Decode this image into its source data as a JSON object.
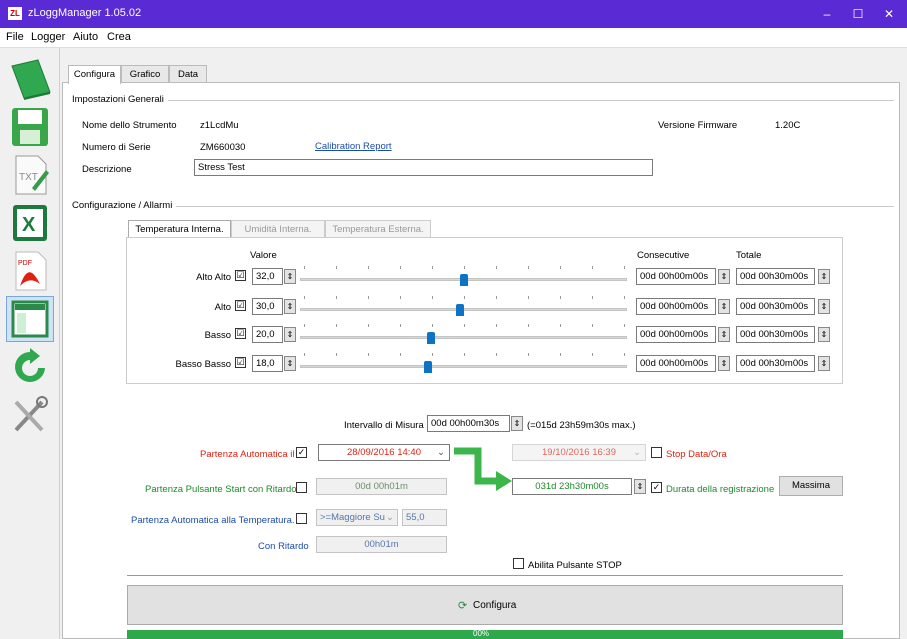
{
  "window": {
    "app_badge": "ZL",
    "title": "zLoggManager 1.05.02",
    "minimize": "–",
    "maximize": "☐",
    "close": "✕"
  },
  "menu": [
    "File",
    "Logger",
    "Aiuto",
    "Crea"
  ],
  "sidebar": [
    {
      "name": "book-icon"
    },
    {
      "name": "save-icon"
    },
    {
      "name": "txt-file-icon"
    },
    {
      "name": "excel-icon"
    },
    {
      "name": "pdf-icon"
    },
    {
      "name": "window-layout-icon"
    },
    {
      "name": "refresh-icon"
    },
    {
      "name": "tools-icon"
    }
  ],
  "tabs": [
    "Configura",
    "Grafico",
    "Data"
  ],
  "general": {
    "section_title": "Impostazioni Generali",
    "instrument_label": "Nome dello Strumento",
    "instrument_value": "z1LcdMu",
    "serial_label": "Numero di Serie",
    "serial_value": "ZM660030",
    "calibration_link": "Calibration Report",
    "description_label": "Descrizione",
    "description_value": "Stress Test",
    "firmware_label": "Versione Firmware",
    "firmware_value": "1.20C"
  },
  "config": {
    "section_title": "Configurazione / Allarmi",
    "subtabs": [
      "Temperatura Interna.",
      "Umidità Interna.",
      "Temperatura Esterna."
    ],
    "valore_header": "Valore",
    "consecutive_header": "Consecutive",
    "totale_header": "Totale",
    "alarms": [
      {
        "label": "Alto Alto",
        "checked": "☑",
        "value": "32,0",
        "level": 0.5,
        "consecutive": "00d 00h00m00s",
        "totale": "00d 00h30m00s"
      },
      {
        "label": "Alto",
        "checked": "☑",
        "value": "30,0",
        "level": 0.49,
        "consecutive": "00d 00h00m00s",
        "totale": "00d 00h30m00s"
      },
      {
        "label": "Basso",
        "checked": "☑",
        "value": "20,0",
        "level": 0.4,
        "consecutive": "00d 00h00m00s",
        "totale": "00d 00h30m00s"
      },
      {
        "label": "Basso Basso",
        "checked": "☑",
        "value": "18,0",
        "level": 0.39,
        "consecutive": "00d 00h00m00s",
        "totale": "00d 00h30m00s"
      }
    ]
  },
  "measure": {
    "interval_label": "Intervallo di Misura",
    "interval_value": "00d 00h00m30s",
    "interval_max": "(=015d 23h59m30s max.)"
  },
  "start": {
    "auto_label": "Partenza Automatica il",
    "auto_date": "28/09/2016 14:40",
    "stop_date": "19/10/2016 16:39",
    "stop_label": "Stop Data/Ora",
    "button_label": "Partenza Pulsante Start con Ritardo",
    "button_delay": "00d 00h01m",
    "duration_value": "031d 23h30m00s",
    "duration_label": "Durata della registrazione",
    "max_button": "Massima",
    "temp_label": "Partenza Automatica alla Temperatura.",
    "temp_condition": ">=Maggiore Su",
    "temp_value": "55,0",
    "delay_label": "Con Ritardo",
    "delay_value": "00h01m",
    "stop_button_label": "Abilita Pulsante STOP"
  },
  "actions": {
    "configure_label": "Configura",
    "progress_text": "00%",
    "progress": 1.0
  },
  "colors": {
    "titlebar": "#5a2bd4",
    "slider": "#0e72c5",
    "arrow": "#3cb54a",
    "progress": "#2ea84a",
    "red": "#d21",
    "green": "#1c8a2a",
    "blue": "#1b4da8"
  }
}
